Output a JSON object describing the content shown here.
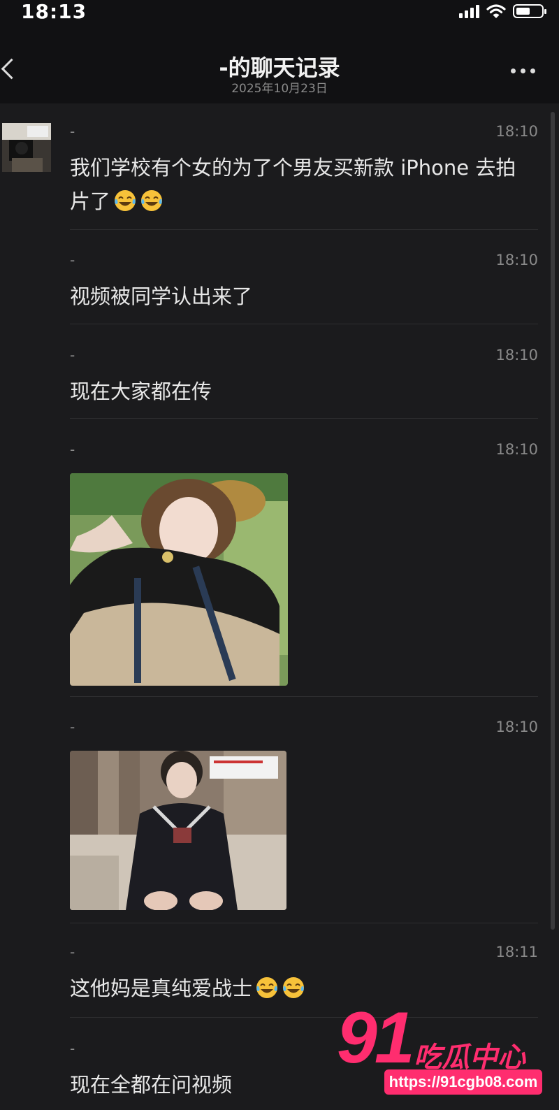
{
  "status_bar": {
    "time": "18:13",
    "battery_level": 0.55
  },
  "header": {
    "back_icon": "chevron-left-icon",
    "title": "-的聊天记录",
    "subtitle": "2025年10月23日",
    "more_icon": "ellipsis-icon"
  },
  "messages": [
    {
      "sender": "-",
      "time": "18:10",
      "text": "我们学校有个女的为了个男友买新款 iPhone 去拍片了",
      "emoji": [
        "laughing-tears-emoji",
        "laughing-tears-emoji"
      ]
    },
    {
      "sender": "-",
      "time": "18:10",
      "text": "视频被同学认出来了"
    },
    {
      "sender": "-",
      "time": "18:10",
      "text": "现在大家都在传"
    },
    {
      "sender": "-",
      "time": "18:10",
      "image": "photo-outdoor-girl"
    },
    {
      "sender": "-",
      "time": "18:10",
      "image": "photo-indoor-girl"
    },
    {
      "sender": "-",
      "time": "18:11",
      "text": "这他妈是真纯爱战士",
      "emoji": [
        "laughing-tears-emoji",
        "laughing-tears-emoji"
      ]
    },
    {
      "sender": "-",
      "time": "",
      "text": "现在全都在问视频"
    }
  ],
  "watermark": {
    "number": "91",
    "name": "吃瓜中心",
    "url": "https://91cgb08.com"
  },
  "colors": {
    "background": "#1b1b1d",
    "header": "#111113",
    "watermark": "#ff2d6f"
  }
}
